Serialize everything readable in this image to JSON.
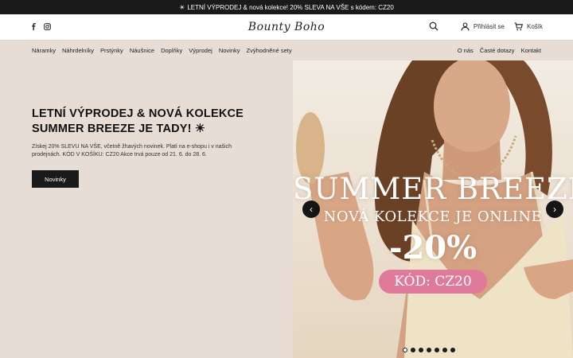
{
  "announcement": {
    "icon": "sun-icon",
    "text": "LETNÍ VÝPRODEJ & nová kolekce! 20% SLEVA NA VŠE s kódem: CZ20"
  },
  "header": {
    "logo_text": "Bounty Boho",
    "social_icons": [
      "facebook-icon",
      "instagram-icon"
    ],
    "login_label": "Přihlásit se",
    "cart_label": "Košík"
  },
  "nav": {
    "left": [
      "Náramky",
      "Náhrdelníky",
      "Prstýnky",
      "Náušnice",
      "Doplňky",
      "Výprodej",
      "Novinky",
      "Zvýhodněné sety"
    ],
    "right": [
      "O nás",
      "Časté dotazy",
      "Kontakt"
    ]
  },
  "hero": {
    "title_line1": "LETNÍ VÝPRODEJ & NOVÁ KOLEKCE",
    "title_line2": "SUMMER BREEZE JE TADY! ☀",
    "text": "Získej 20% SLEVU NA VŠE, včetně žhavých novinek. Platí na e-shopu i v našich prodejnách. KÓD V KOŠÍKU: CZ20 Akce trvá pouze od 21. 6. do 28. 6.",
    "button_label": "Novinky"
  },
  "slide": {
    "title": "SUMMER BREEZE",
    "subtitle": "NOVÁ KOLEKCE JE ONLINE",
    "discount": "-20%",
    "code": "KÓD: CZ20",
    "accent_color": "#e07a9a",
    "dot_count": 7,
    "active_dot": 0
  },
  "colors": {
    "beige": "#e7ddd5",
    "dark": "#1a1a1a"
  }
}
